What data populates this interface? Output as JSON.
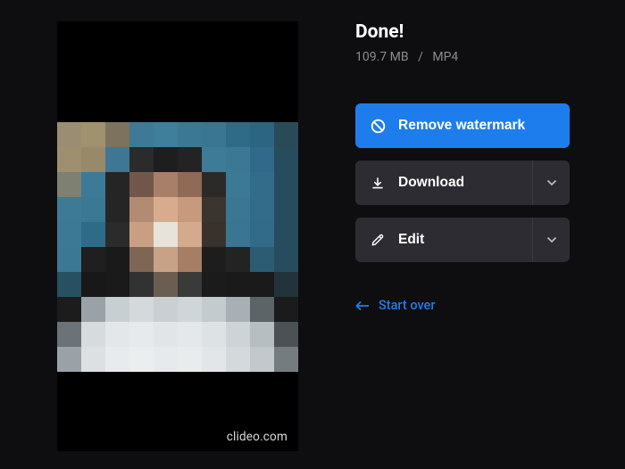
{
  "title": "Done!",
  "meta": {
    "size": "109.7 MB",
    "separator": "/",
    "format": "MP4"
  },
  "buttons": {
    "remove_watermark": "Remove watermark",
    "download": "Download",
    "edit": "Edit"
  },
  "start_over": "Start over",
  "watermark": "clideo.com",
  "colors": {
    "accent": "#1e7ded",
    "button_secondary": "#2c2c32",
    "bg": "#0e0e10"
  }
}
